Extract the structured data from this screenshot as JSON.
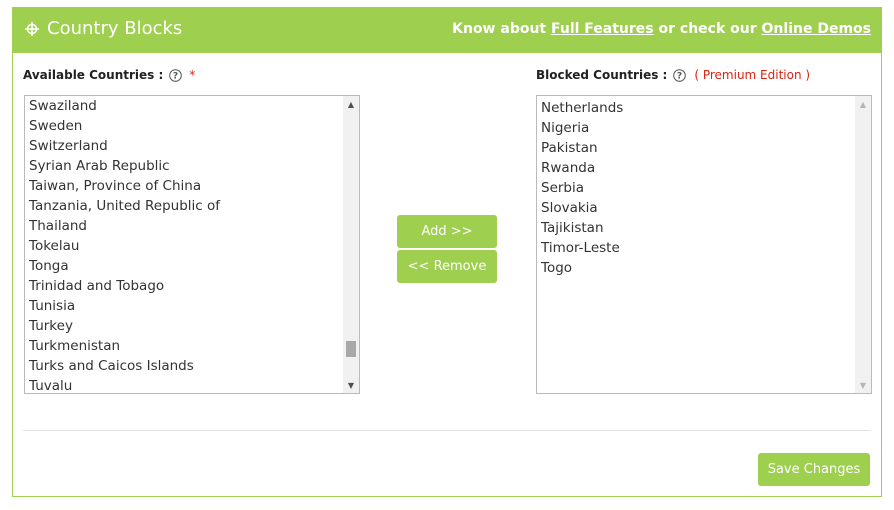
{
  "header": {
    "title": "Country Blocks",
    "right_prefix": "Know about ",
    "full_features_link": "Full Features",
    "right_middle": " or check our ",
    "online_demos_link": "Online Demos"
  },
  "available": {
    "label": "Available Countries :",
    "required_mark": "*",
    "items": [
      "Swaziland",
      "Sweden",
      "Switzerland",
      "Syrian Arab Republic",
      "Taiwan, Province of China",
      "Tanzania, United Republic of",
      "Thailand",
      "Tokelau",
      "Tonga",
      "Trinidad and Tobago",
      "Tunisia",
      "Turkey",
      "Turkmenistan",
      "Turks and Caicos Islands",
      "Tuvalu"
    ]
  },
  "blocked": {
    "label": "Blocked Countries :",
    "premium_note": "( Premium Edition )",
    "items": [
      "Netherlands",
      "Nigeria",
      "Pakistan",
      "Rwanda",
      "Serbia",
      "Slovakia",
      "Tajikistan",
      "Timor-Leste",
      "Togo"
    ]
  },
  "buttons": {
    "add": "Add >>",
    "remove": "<< Remove",
    "save": "Save Changes"
  },
  "colors": {
    "accent": "#9ecf4f",
    "required": "#d9230f"
  }
}
